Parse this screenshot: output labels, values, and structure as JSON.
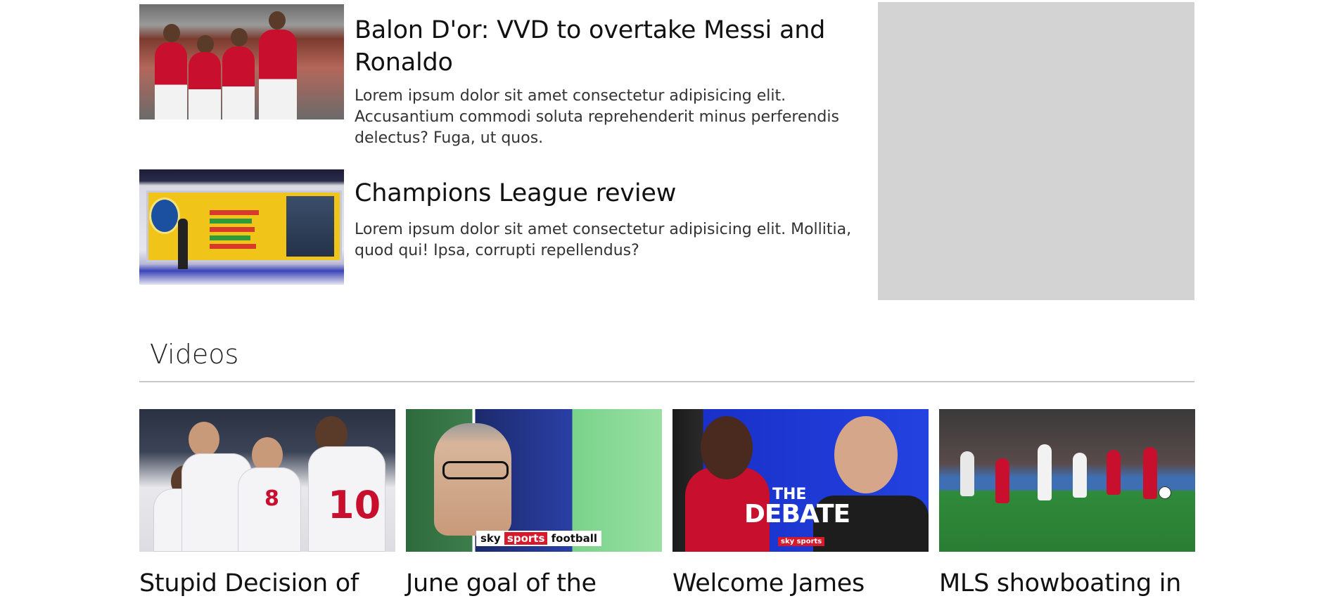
{
  "articles": [
    {
      "title": "Balon D'or: VVD to overtake Messi and Ronaldo",
      "description": "Lorem ipsum dolor sit amet consectetur adipisicing elit. Accusantium commodi soluta reprehenderit minus perferendis delectus? Fuga, ut quos."
    },
    {
      "title": "Champions League review",
      "description": "Lorem ipsum dolor sit amet consectetur adipisicing elit. Mollitia, quod qui! Ipsa, corrupti repellendus?"
    }
  ],
  "sidebar": {
    "ad_color": "#d3d3d3"
  },
  "videos": {
    "heading": "Videos",
    "items": [
      {
        "title": "Stupid Decision of"
      },
      {
        "title": "June goal of the",
        "thumb_caption_sky": "sky",
        "thumb_caption_sports": "sports",
        "thumb_caption_football": "football"
      },
      {
        "title": "Welcome James",
        "thumb_caption_the": "THE",
        "thumb_caption_debate": "DEBATE",
        "thumb_caption_skysports": "sky sports"
      },
      {
        "title": "MLS showboating in"
      }
    ]
  },
  "colors": {
    "text": "#111111",
    "divider": "#c8c8c8",
    "background": "#ffffff"
  }
}
